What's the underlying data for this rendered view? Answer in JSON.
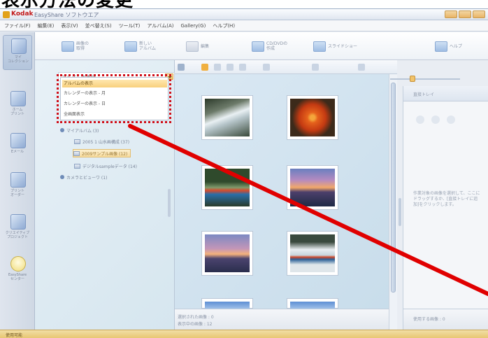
{
  "caption": "表示方法の変更",
  "window": {
    "title_brand": "Kodak",
    "title_rest": "EasyShare ソフトウエア"
  },
  "menu": [
    "ファイル(F)",
    "編集(E)",
    "表示(V)",
    "並べ替え(S)",
    "ツール(T)",
    "アルバム(A)",
    "Gallery(G)",
    "ヘルプ(H)"
  ],
  "toolbar": {
    "buttons": [
      {
        "label": "画像の\n取得",
        "icon": "camera-icon"
      },
      {
        "label": "新しい\nアルバム",
        "icon": "album-icon"
      },
      {
        "label": "編集",
        "icon": "edit-icon"
      },
      {
        "label": "CD/DVDの\n作成",
        "icon": "disc-icon"
      },
      {
        "label": "スライドショー",
        "icon": "slideshow-icon"
      },
      {
        "label": "ヘルプ",
        "icon": "help-icon"
      }
    ]
  },
  "rail": {
    "items": [
      {
        "label": "マイ\nコレクション",
        "icon": "collection-icon"
      },
      {
        "label": "ホーム\nプリント",
        "icon": "print-icon"
      },
      {
        "label": "Eメール",
        "icon": "email-icon"
      },
      {
        "label": "プリント\nオーダー",
        "icon": "order-icon"
      },
      {
        "label": "クリエイティブ\nプロジェクト",
        "icon": "project-icon"
      },
      {
        "label": "EasyShare\nセンター",
        "icon": "bulb-icon"
      }
    ]
  },
  "album_pane": {
    "dropdown_value": "アルバムの表示",
    "options": [
      "アルバムの表示",
      "カレンダーの表示 - 月",
      "カレンダーの表示 - 日",
      "全画面表示"
    ],
    "tree": [
      {
        "label": "マイアルバム (3)",
        "level": 0,
        "selected": false
      },
      {
        "label": "2005 1 山水画構成 (37)",
        "level": 1,
        "selected": false
      },
      {
        "label": "2009サンプル画像 (12)",
        "level": 1,
        "selected": true
      },
      {
        "label": "デジタルsampleデータ (14)",
        "level": 1,
        "selected": false
      },
      {
        "label": "カメラとビューワ (1)",
        "level": 0,
        "selected": false
      }
    ]
  },
  "thumb_pane": {
    "footer_selected": "選択された画像 : 0",
    "footer_shown": "表示中の画像 : 12"
  },
  "tray": {
    "title": "直接トレイ",
    "hint": "作業対象の画像を選択して、ここにドラッグするか、[直接トレイに追加]をクリックします。",
    "footer": "使用する画像 : 0"
  },
  "status": "使用可能",
  "colors": {
    "highlight": "#d0101a",
    "arrow": "#e00000",
    "accent": "#f0b040"
  }
}
